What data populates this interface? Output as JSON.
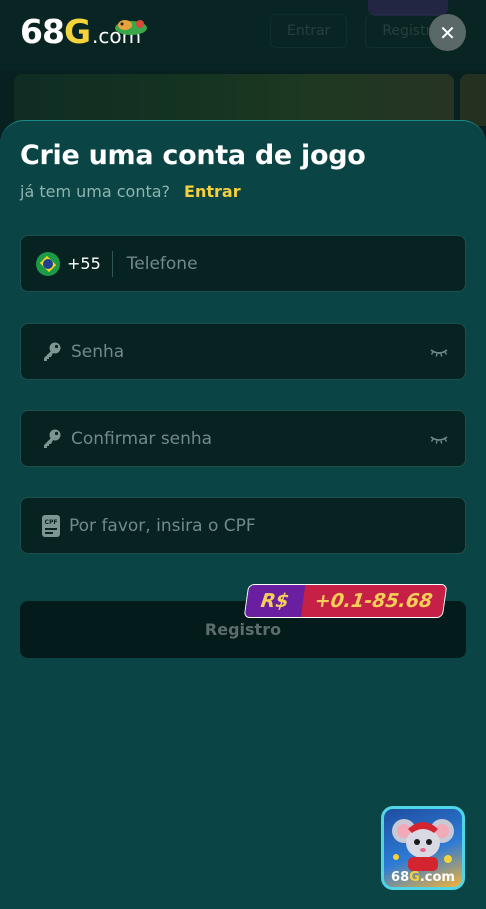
{
  "logo": {
    "number": "68",
    "letter": "G",
    "suffix": ".com"
  },
  "background": {
    "tabs": [
      "Entrar",
      "Registro"
    ]
  },
  "modal": {
    "title": "Crie uma conta de jogo",
    "subtitle": "já tem uma conta?",
    "login_link": "Entrar",
    "phone": {
      "dial_code": "+55",
      "placeholder": "Telefone",
      "value": ""
    },
    "password": {
      "placeholder": "Senha",
      "value": ""
    },
    "confirm_password": {
      "placeholder": "Confirmar senha",
      "value": ""
    },
    "cpf": {
      "placeholder": "Por favor, insira o CPF",
      "value": ""
    },
    "register_label": "Registro",
    "bonus": {
      "currency": "R$",
      "range": "+0.1-85.68"
    }
  },
  "mascot_badge": {
    "brand_number": "68",
    "brand_letter": "G",
    "brand_suffix": ".com"
  },
  "colors": {
    "accent_yellow": "#f6cf3e",
    "panel": "#0a4444",
    "field": "#062221",
    "bonus_purple": "#6a1fa0",
    "bonus_red": "#c72046"
  },
  "icons": {
    "close": "close-icon",
    "flag": "brazil-flag-icon",
    "password": "key-icon",
    "visibility": "eye-closed-icon",
    "cpf": "cpf-card-icon"
  }
}
